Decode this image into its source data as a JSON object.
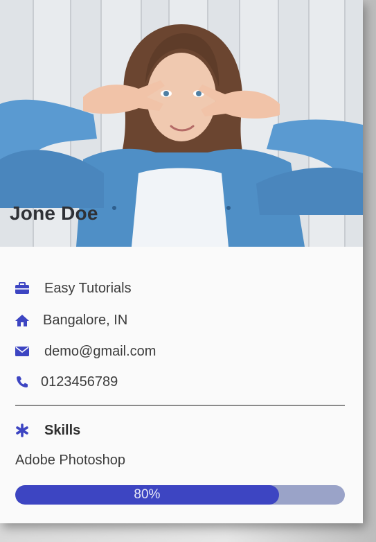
{
  "profile": {
    "name": "Jone Doe"
  },
  "info": {
    "company": "Easy Tutorials",
    "location": "Bangalore, IN",
    "email": "demo@gmail.com",
    "phone": "0123456789"
  },
  "skills": {
    "heading": "Skills",
    "items": [
      {
        "name": "Adobe Photoshop",
        "progress_label": "80%",
        "progress": 0.8
      }
    ]
  },
  "icons": {
    "company": "briefcase-icon",
    "location": "home-icon",
    "email": "envelope-icon",
    "phone": "phone-icon",
    "skills": "asterisk-icon"
  },
  "colors": {
    "accent": "#3d45c2",
    "track": "#9aa3c8",
    "text": "#3c3c3c"
  }
}
